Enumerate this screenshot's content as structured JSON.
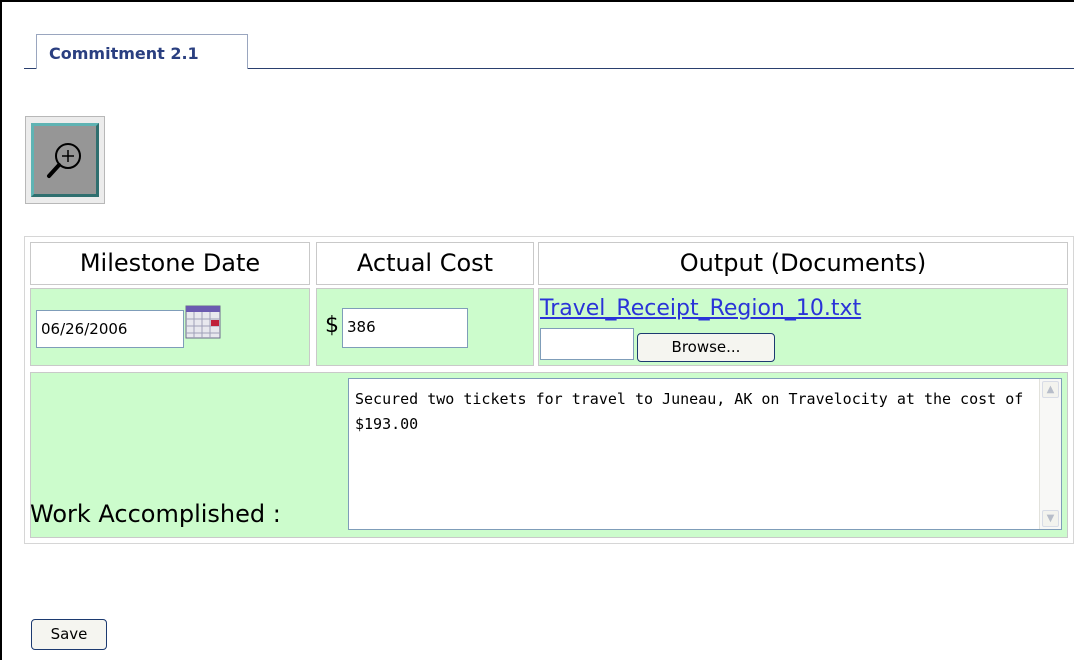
{
  "tab": {
    "label": "Commitment 2.1"
  },
  "zoom": {
    "icon": "zoom-in-icon"
  },
  "table": {
    "headers": [
      "Milestone Date",
      "Actual Cost",
      "Output (Documents)"
    ],
    "milestone_date": "06/26/2006",
    "calendar_icon": "calendar-icon",
    "currency_symbol": "$",
    "actual_cost": "386",
    "document_link": "Travel_Receipt_Region_10.txt",
    "file_input_value": "",
    "browse_label": "Browse...",
    "work_label": "Work Accomplished :",
    "work_text": "Secured two tickets for travel to Juneau, AK on Travelocity at the cost of $193.00"
  },
  "save_label": "Save",
  "colors": {
    "row_background": "#ccfccc",
    "link": "#2a33d8",
    "tab_text": "#2a3f80"
  }
}
